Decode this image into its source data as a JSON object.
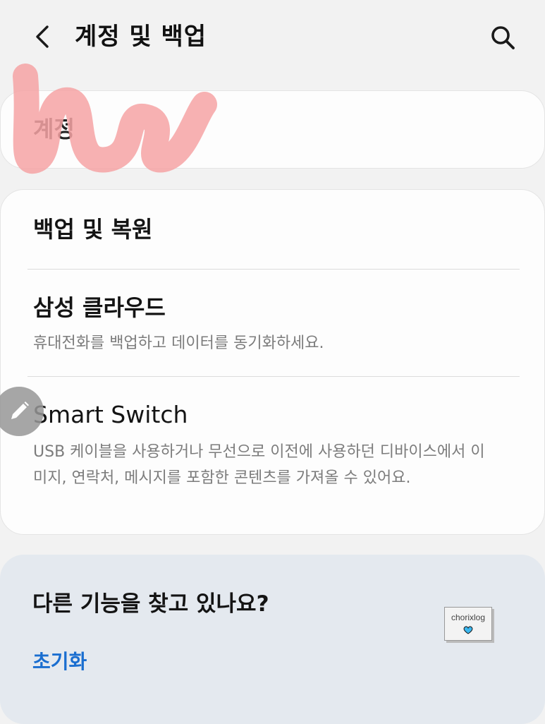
{
  "header": {
    "back_icon": "chevron-left-icon",
    "title": "계정 및 백업",
    "search_icon": "search-icon"
  },
  "account_card": {
    "title": "계정"
  },
  "backup_card": {
    "items": [
      {
        "title": "백업 및 복원"
      },
      {
        "title": "삼성 클라우드",
        "description": "휴대전화를 백업하고 데이터를 동기화하세요."
      },
      {
        "title": "Smart Switch",
        "description": "USB 케이블을 사용하거나 무선으로 이전에 사용하던 디바이스에서 이미지, 연락처, 메시지를 포함한 콘텐츠를 가져올 수 있어요."
      }
    ]
  },
  "help_card": {
    "title": "다른 기능을 찾고 있나요?",
    "link": "초기화"
  },
  "watermark": {
    "text": "chorixlog",
    "icon": "heart-icon",
    "heart_color": "#3bb8f0"
  },
  "colors": {
    "accent_link": "#1a6ed0",
    "scribble": "#f6a3a5",
    "background": "#f2f2f2",
    "card": "#fdfdfd",
    "help_card": "#e4e9ef"
  }
}
